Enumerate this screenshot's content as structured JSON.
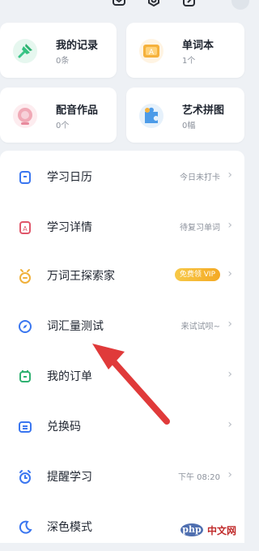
{
  "cards": [
    {
      "title": "我的记录",
      "sub": "0条"
    },
    {
      "title": "单词本",
      "sub": "1个"
    },
    {
      "title": "配音作品",
      "sub": "0个"
    },
    {
      "title": "艺术拼图",
      "sub": "0幅"
    }
  ],
  "list": [
    {
      "label": "学习日历",
      "value": "今日未打卡",
      "icon": "calendar-icon"
    },
    {
      "label": "学习详情",
      "value": "待复习单词",
      "icon": "detail-icon"
    },
    {
      "label": "万词王探索家",
      "badge": "免费领 VIP",
      "icon": "explorer-icon"
    },
    {
      "label": "词汇量测试",
      "value": "来试试呗~",
      "icon": "compass-icon"
    },
    {
      "label": "我的订单",
      "value": "",
      "icon": "order-icon"
    },
    {
      "label": "兑换码",
      "value": "",
      "icon": "redeem-icon"
    },
    {
      "label": "提醒学习",
      "value": "下午 08:20",
      "icon": "alarm-icon"
    },
    {
      "label": "深色模式",
      "value": "",
      "icon": "moon-icon"
    }
  ],
  "chevron": "›",
  "watermark": {
    "logo": "php",
    "text": "中文网"
  },
  "colors": {
    "accent": "#3a76f0",
    "arrow": "#e03a3a",
    "badge": "#f4b032"
  }
}
